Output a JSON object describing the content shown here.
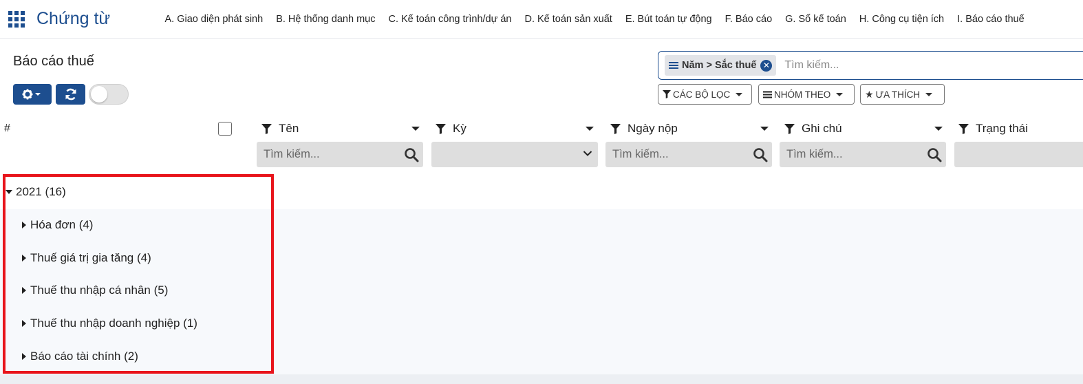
{
  "app": {
    "brand": "Chứng từ"
  },
  "menu": [
    "A. Giao diện phát sinh",
    "B. Hệ thống danh mục",
    "C. Kế toán công trình/dự án",
    "D. Kế toán sản xuất",
    "E. Bút toán tự động",
    "F. Báo cáo",
    "G. Sổ kế toán",
    "H. Công cụ tiện ích",
    "I. Báo cáo thuế"
  ],
  "page": {
    "title": "Báo cáo thuế"
  },
  "search": {
    "facet": "Năm > Sắc thuế",
    "placeholder": "Tìm kiếm..."
  },
  "filters": {
    "filters_label": "CÁC BỘ LỌC",
    "groupby_label": "NHÓM THEO",
    "favorites_label": "ƯA THÍCH"
  },
  "table": {
    "hash": "#",
    "columns": [
      "Tên",
      "Kỳ",
      "Ngày nộp",
      "Ghi chú",
      "Trạng thái"
    ],
    "filter_placeholder": "Tìm kiếm..."
  },
  "groups": {
    "year": "2021 (16)",
    "items": [
      "Hóa đơn (4)",
      "Thuế giá trị gia tăng (4)",
      "Thuế thu nhập cá nhân (5)",
      "Thuế thu nhập doanh nghiệp (1)",
      "Báo cáo tài chính (2)"
    ]
  },
  "colors": {
    "primary": "#1d4e8f",
    "highlight": "#e8141b"
  },
  "icons": [
    "apps-grid-icon",
    "gear-icon",
    "refresh-icon",
    "funnel-icon",
    "star-icon",
    "search-icon",
    "close-icon"
  ]
}
